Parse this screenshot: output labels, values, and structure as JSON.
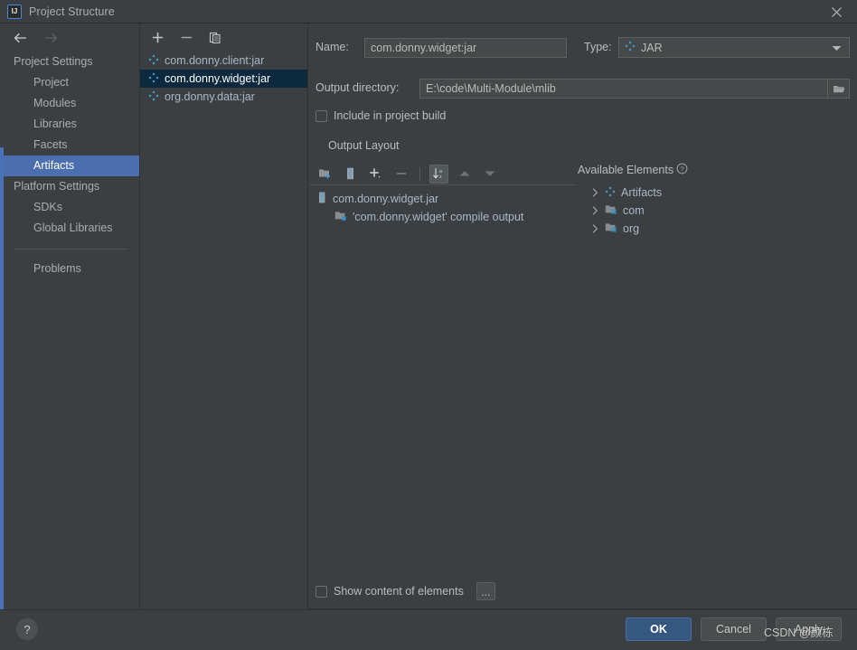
{
  "window": {
    "title": "Project Structure",
    "app_icon_text": "IJ",
    "close_icon": "close-icon"
  },
  "navigation": {
    "back_icon": "arrow-left-icon",
    "forward_icon": "arrow-right-icon"
  },
  "sidebar": {
    "groups": [
      {
        "label": "Project Settings",
        "items": [
          {
            "label": "Project",
            "selected": false
          },
          {
            "label": "Modules",
            "selected": false
          },
          {
            "label": "Libraries",
            "selected": false
          },
          {
            "label": "Facets",
            "selected": false
          },
          {
            "label": "Artifacts",
            "selected": true
          }
        ]
      },
      {
        "label": "Platform Settings",
        "items": [
          {
            "label": "SDKs",
            "selected": false
          },
          {
            "label": "Global Libraries",
            "selected": false
          }
        ]
      }
    ],
    "problems": {
      "label": "Problems",
      "selected": false
    }
  },
  "artifacts_panel": {
    "toolbar": [
      {
        "name": "add-artifact-button",
        "icon": "plus-icon"
      },
      {
        "name": "remove-artifact-button",
        "icon": "minus-icon"
      },
      {
        "name": "copy-artifact-button",
        "icon": "copy-icon"
      }
    ],
    "items": [
      {
        "label": "com.donny.client:jar",
        "icon": "artifact-icon",
        "selected": false
      },
      {
        "label": "com.donny.widget:jar",
        "icon": "artifact-icon",
        "selected": true
      },
      {
        "label": "org.donny.data:jar",
        "icon": "artifact-icon",
        "selected": false
      }
    ]
  },
  "editor": {
    "name_label": "Name:",
    "name_value": "com.donny.widget:jar",
    "type_label": "Type:",
    "type_value": "JAR",
    "type_icon": "artifact-icon",
    "output_dir_label": "Output directory:",
    "output_dir_value": "E:\\code\\Multi-Module\\mlib",
    "browse_icon": "folder-open-icon",
    "include_in_build_label": "Include in project build",
    "include_in_build_checked": false,
    "output_layout_label": "Output Layout",
    "layout_toolbar": [
      {
        "name": "add-directory-button",
        "icon": "folder-add-icon",
        "active": false
      },
      {
        "name": "add-archive-button",
        "icon": "archive-icon",
        "active": false
      },
      {
        "name": "add-element-button",
        "icon": "plus-dropdown-icon",
        "active": false
      },
      {
        "name": "remove-element-button",
        "icon": "minus-icon",
        "active": false
      },
      {
        "name": "sort-elements-button",
        "icon": "sort-az-icon",
        "active": true
      },
      {
        "name": "move-up-button",
        "icon": "arrow-up-icon",
        "active": false
      },
      {
        "name": "move-down-button",
        "icon": "arrow-down-icon",
        "active": false
      }
    ],
    "layout_tree": [
      {
        "label": "com.donny.widget.jar",
        "icon": "jar-icon",
        "indent": 0
      },
      {
        "label": "'com.donny.widget' compile output",
        "icon": "compile-output-icon",
        "indent": 1
      }
    ],
    "available_elements_label": "Available Elements",
    "available_help_icon": "help-circle-icon",
    "available_tree": [
      {
        "label": "Artifacts",
        "icon": "artifact-icon",
        "chevron": "chevron-right-icon"
      },
      {
        "label": "com",
        "icon": "package-folder-icon",
        "chevron": "chevron-right-icon"
      },
      {
        "label": "org",
        "icon": "package-folder-icon",
        "chevron": "chevron-right-icon"
      }
    ],
    "show_content_label": "Show content of elements",
    "show_content_checked": false,
    "more_button_label": "..."
  },
  "footer": {
    "help_label": "?",
    "ok_label": "OK",
    "cancel_label": "Cancel",
    "apply_label": "Apply"
  },
  "watermark": {
    "text": "CSDN @颜栋"
  },
  "colors": {
    "window_bg": "#3c3f41",
    "field_bg": "#45494a",
    "selection_blue": "#4b6eaf",
    "inactive_selection": "#0d293e",
    "accent_cyan": "#3592c4",
    "ok_button": "#365880",
    "text": "#bbbbbb",
    "tree_text": "#a9b7c6"
  }
}
